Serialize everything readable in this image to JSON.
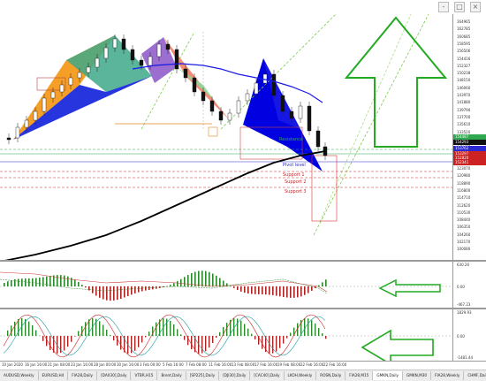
{
  "window": {
    "controls": [
      "-",
      "□",
      "×"
    ]
  },
  "price_axis": {
    "ticks": [
      "164965",
      "162785",
      "160685",
      "158595",
      "156506",
      "154416",
      "152327",
      "150238",
      "148150",
      "146060",
      "143970",
      "141880",
      "139790",
      "137700",
      "135610",
      "133520",
      "131430",
      "129340",
      "127250",
      "125160",
      "123070",
      "120980",
      "118890",
      "116800",
      "114710",
      "112620",
      "110530",
      "108440",
      "106350",
      "104260",
      "102170",
      "100080"
    ],
    "labels": [
      {
        "text": "154487",
        "color": "#2fa84f"
      },
      {
        "text": "154293",
        "color": "#111111"
      },
      {
        "text": "153762",
        "color": "#2a2ad0"
      },
      {
        "text": "153297",
        "color": "#cc2222"
      },
      {
        "text": "152820",
        "color": "#cc2222"
      },
      {
        "text": "152341",
        "color": "#cc2222"
      }
    ]
  },
  "levels": {
    "resistance": "Resistance",
    "pivot": "Pivot level",
    "support1": "Support 1",
    "support2": "Support 2",
    "support3": "Support 3"
  },
  "indicator1_axis": {
    "top": "630.26",
    "mid": "0.00",
    "bottom": "-467.23"
  },
  "indicator2_axis": {
    "top": "1829.93",
    "mid": "0.00",
    "bottom": "-1481.44"
  },
  "time_axis": [
    "10 Jan 2020",
    "16 Jan 16:00",
    "21 Jan 08:00",
    "23 Jan 16:00",
    "28 Jan 00:00",
    "30 Jan 16:00",
    "3 Feb 00:00",
    "5 Feb 16:00",
    "7 Feb 08:00",
    "11 Feb 16:00",
    "13 Feb 08:00",
    "17 Feb 16:00",
    "19 Feb 08:00",
    "22 Feb 16:00",
    "22 Feb 16:00"
  ],
  "tabs": [
    "AUDUSD,Weekly",
    "EURUSD,H4",
    "FIA28,Daily",
    "[DAX30],Daily",
    "VTBR,H15",
    "Brent,Daily",
    "[SP225],Daily",
    "[DJI30],Daily",
    "[CAC40],Daily",
    "LKOH,Weekly",
    "ROSN,Daily",
    "FIA28,M15",
    "GMKN,Daily",
    "GMKN,M30",
    "FIA28,Weekly",
    "CHMF,Daily"
  ],
  "active_tab": 12,
  "colors": {
    "bull": "#2a8a2a",
    "bear": "#cc2222",
    "pattern_blue": "#0000e0",
    "arrow": "#22aa22",
    "ma_blue": "#1a1ae6",
    "ma_black": "#000000"
  }
}
